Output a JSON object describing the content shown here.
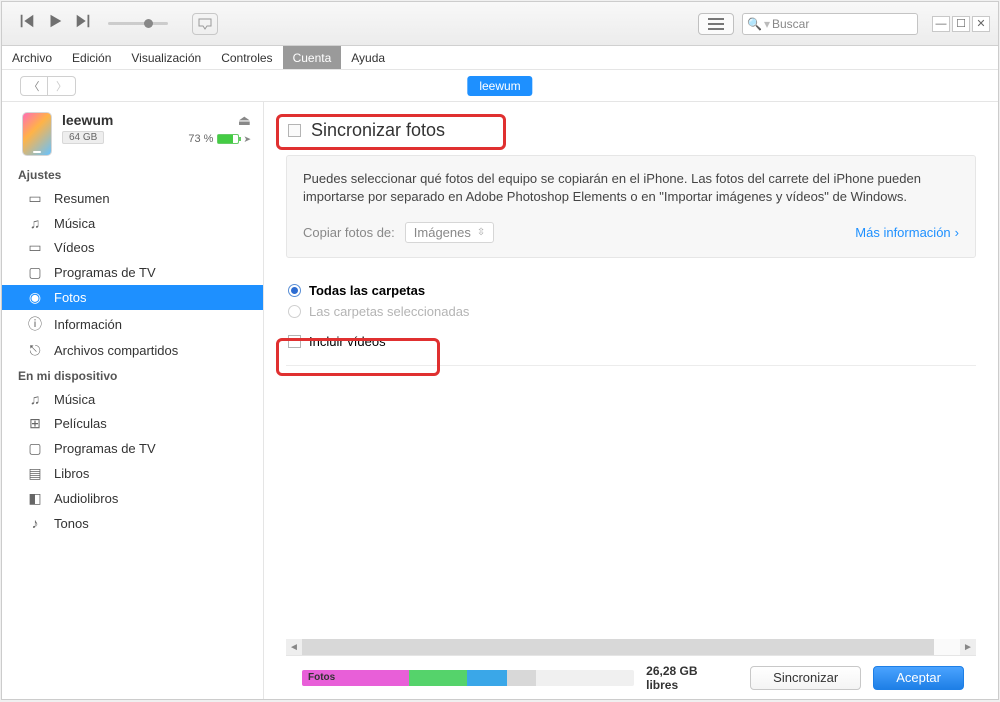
{
  "toolbar": {
    "search_placeholder": "Buscar"
  },
  "menubar": [
    "Archivo",
    "Edición",
    "Visualización",
    "Controles",
    "Cuenta",
    "Ayuda"
  ],
  "menubar_selected_index": 4,
  "tab_name": "leewum",
  "device": {
    "name": "leewum",
    "capacity": "64 GB",
    "battery_pct": "73 %"
  },
  "sidebar": {
    "section_settings": "Ajustes",
    "settings_items": [
      {
        "icon": "doc-icon",
        "glyph": "▭",
        "label": "Resumen"
      },
      {
        "icon": "music-icon",
        "glyph": "♫",
        "label": "Música"
      },
      {
        "icon": "video-icon",
        "glyph": "▭",
        "label": "Vídeos"
      },
      {
        "icon": "tv-icon",
        "glyph": "▢",
        "label": "Programas de TV"
      },
      {
        "icon": "photos-icon",
        "glyph": "◉",
        "label": "Fotos",
        "selected": true
      },
      {
        "icon": "info-icon",
        "glyph": "ⓘ",
        "label": "Información"
      },
      {
        "icon": "share-icon",
        "glyph": "⎋",
        "label": "Archivos compartidos"
      }
    ],
    "section_device": "En mi dispositivo",
    "device_items": [
      {
        "icon": "music-icon",
        "glyph": "♫",
        "label": "Música"
      },
      {
        "icon": "film-icon",
        "glyph": "⊞",
        "label": "Películas"
      },
      {
        "icon": "tv-icon",
        "glyph": "▢",
        "label": "Programas de TV"
      },
      {
        "icon": "book-icon",
        "glyph": "▤",
        "label": "Libros"
      },
      {
        "icon": "audio-icon",
        "glyph": "◧",
        "label": "Audiolibros"
      },
      {
        "icon": "bell-icon",
        "glyph": "♪",
        "label": "Tonos"
      }
    ]
  },
  "main": {
    "sync_title": "Sincronizar fotos",
    "info_desc": "Puedes seleccionar qué fotos del equipo se copiarán en el iPhone. Las fotos del carrete del iPhone pueden importarse por separado en Adobe Photoshop Elements o en \"Importar imágenes y vídeos\" de Windows.",
    "copy_label": "Copiar fotos de:",
    "copy_source": "Imágenes",
    "more_info": "Más información",
    "radio_all": "Todas las carpetas",
    "radio_selected": "Las carpetas seleccionadas",
    "include_videos": "Incluir vídeos"
  },
  "footer": {
    "seg_photos": "Fotos",
    "free_label": "26,28 GB libres",
    "sync_btn": "Sincronizar",
    "ok_btn": "Aceptar"
  }
}
